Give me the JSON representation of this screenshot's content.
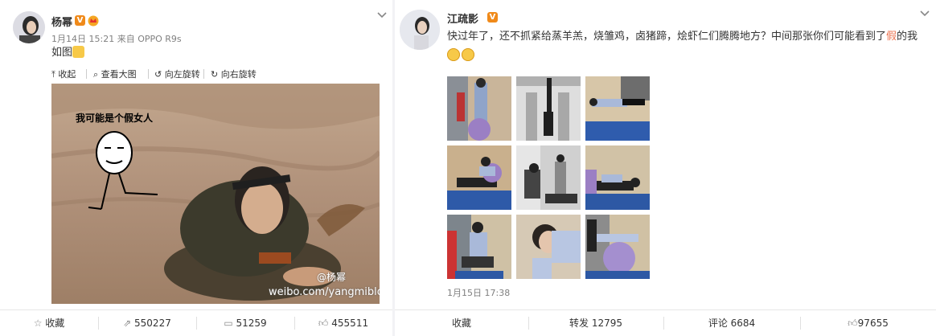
{
  "left_post": {
    "author_name": "杨幂",
    "verified_badge": "V",
    "timestamp": "1月14日 15:21",
    "source": "来自 OPPO R9s",
    "text": "如图",
    "media_toolbar": {
      "collapse": "收起",
      "view_large": "查看大图",
      "rotate_left": "向左旋转",
      "rotate_right": "向右旋转"
    },
    "image": {
      "meme_caption": "我可能是个假女人",
      "watermark_name": "@杨幂",
      "watermark_url": "weibo.com/yangmiblog"
    },
    "footer": {
      "favorite": "收藏",
      "repost_count": "550227",
      "comment_count": "51259",
      "like_count": "455511"
    }
  },
  "right_post": {
    "author_name": "江疏影",
    "verified_badge": "V",
    "text_before": "快过年了，还不抓紧给蒸羊羔，烧雏鸡，卤猪蹄，烩虾仁们腾腾地方？中间那张你们可能看到了",
    "text_highlight": "假",
    "text_after": "的我",
    "timestamp": "1月15日 17:38",
    "footer": {
      "favorite": "收藏",
      "repost": "转发 12795",
      "comment": "评论 6684",
      "like_count": "97655"
    }
  },
  "colors": {
    "link_highlight": "#eb7350",
    "verified_badge": "#f08a1a",
    "meta_text": "#808080"
  },
  "icons": [
    "chevron-down-icon",
    "collapse-icon",
    "magnify-icon",
    "rotate-left-icon",
    "rotate-right-icon",
    "star-icon",
    "repost-icon",
    "comment-icon",
    "thumbs-up-icon",
    "smile-emoji",
    "grin-emoji",
    "cat-emoji"
  ]
}
